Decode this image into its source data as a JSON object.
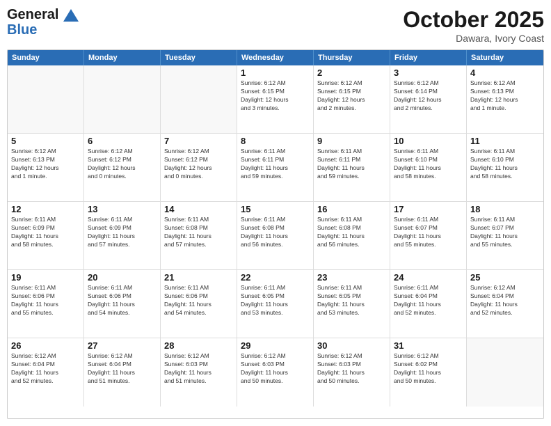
{
  "header": {
    "logo_line1": "General",
    "logo_line2": "Blue",
    "month": "October 2025",
    "location": "Dawara, Ivory Coast"
  },
  "weekdays": [
    "Sunday",
    "Monday",
    "Tuesday",
    "Wednesday",
    "Thursday",
    "Friday",
    "Saturday"
  ],
  "weeks": [
    [
      {
        "day": "",
        "info": "",
        "empty": true
      },
      {
        "day": "",
        "info": "",
        "empty": true
      },
      {
        "day": "",
        "info": "",
        "empty": true
      },
      {
        "day": "1",
        "info": "Sunrise: 6:12 AM\nSunset: 6:15 PM\nDaylight: 12 hours\nand 3 minutes."
      },
      {
        "day": "2",
        "info": "Sunrise: 6:12 AM\nSunset: 6:15 PM\nDaylight: 12 hours\nand 2 minutes."
      },
      {
        "day": "3",
        "info": "Sunrise: 6:12 AM\nSunset: 6:14 PM\nDaylight: 12 hours\nand 2 minutes."
      },
      {
        "day": "4",
        "info": "Sunrise: 6:12 AM\nSunset: 6:13 PM\nDaylight: 12 hours\nand 1 minute."
      }
    ],
    [
      {
        "day": "5",
        "info": "Sunrise: 6:12 AM\nSunset: 6:13 PM\nDaylight: 12 hours\nand 1 minute."
      },
      {
        "day": "6",
        "info": "Sunrise: 6:12 AM\nSunset: 6:12 PM\nDaylight: 12 hours\nand 0 minutes."
      },
      {
        "day": "7",
        "info": "Sunrise: 6:12 AM\nSunset: 6:12 PM\nDaylight: 12 hours\nand 0 minutes."
      },
      {
        "day": "8",
        "info": "Sunrise: 6:11 AM\nSunset: 6:11 PM\nDaylight: 11 hours\nand 59 minutes."
      },
      {
        "day": "9",
        "info": "Sunrise: 6:11 AM\nSunset: 6:11 PM\nDaylight: 11 hours\nand 59 minutes."
      },
      {
        "day": "10",
        "info": "Sunrise: 6:11 AM\nSunset: 6:10 PM\nDaylight: 11 hours\nand 58 minutes."
      },
      {
        "day": "11",
        "info": "Sunrise: 6:11 AM\nSunset: 6:10 PM\nDaylight: 11 hours\nand 58 minutes."
      }
    ],
    [
      {
        "day": "12",
        "info": "Sunrise: 6:11 AM\nSunset: 6:09 PM\nDaylight: 11 hours\nand 58 minutes."
      },
      {
        "day": "13",
        "info": "Sunrise: 6:11 AM\nSunset: 6:09 PM\nDaylight: 11 hours\nand 57 minutes."
      },
      {
        "day": "14",
        "info": "Sunrise: 6:11 AM\nSunset: 6:08 PM\nDaylight: 11 hours\nand 57 minutes."
      },
      {
        "day": "15",
        "info": "Sunrise: 6:11 AM\nSunset: 6:08 PM\nDaylight: 11 hours\nand 56 minutes."
      },
      {
        "day": "16",
        "info": "Sunrise: 6:11 AM\nSunset: 6:08 PM\nDaylight: 11 hours\nand 56 minutes."
      },
      {
        "day": "17",
        "info": "Sunrise: 6:11 AM\nSunset: 6:07 PM\nDaylight: 11 hours\nand 55 minutes."
      },
      {
        "day": "18",
        "info": "Sunrise: 6:11 AM\nSunset: 6:07 PM\nDaylight: 11 hours\nand 55 minutes."
      }
    ],
    [
      {
        "day": "19",
        "info": "Sunrise: 6:11 AM\nSunset: 6:06 PM\nDaylight: 11 hours\nand 55 minutes."
      },
      {
        "day": "20",
        "info": "Sunrise: 6:11 AM\nSunset: 6:06 PM\nDaylight: 11 hours\nand 54 minutes."
      },
      {
        "day": "21",
        "info": "Sunrise: 6:11 AM\nSunset: 6:06 PM\nDaylight: 11 hours\nand 54 minutes."
      },
      {
        "day": "22",
        "info": "Sunrise: 6:11 AM\nSunset: 6:05 PM\nDaylight: 11 hours\nand 53 minutes."
      },
      {
        "day": "23",
        "info": "Sunrise: 6:11 AM\nSunset: 6:05 PM\nDaylight: 11 hours\nand 53 minutes."
      },
      {
        "day": "24",
        "info": "Sunrise: 6:11 AM\nSunset: 6:04 PM\nDaylight: 11 hours\nand 52 minutes."
      },
      {
        "day": "25",
        "info": "Sunrise: 6:12 AM\nSunset: 6:04 PM\nDaylight: 11 hours\nand 52 minutes."
      }
    ],
    [
      {
        "day": "26",
        "info": "Sunrise: 6:12 AM\nSunset: 6:04 PM\nDaylight: 11 hours\nand 52 minutes."
      },
      {
        "day": "27",
        "info": "Sunrise: 6:12 AM\nSunset: 6:04 PM\nDaylight: 11 hours\nand 51 minutes."
      },
      {
        "day": "28",
        "info": "Sunrise: 6:12 AM\nSunset: 6:03 PM\nDaylight: 11 hours\nand 51 minutes."
      },
      {
        "day": "29",
        "info": "Sunrise: 6:12 AM\nSunset: 6:03 PM\nDaylight: 11 hours\nand 50 minutes."
      },
      {
        "day": "30",
        "info": "Sunrise: 6:12 AM\nSunset: 6:03 PM\nDaylight: 11 hours\nand 50 minutes."
      },
      {
        "day": "31",
        "info": "Sunrise: 6:12 AM\nSunset: 6:02 PM\nDaylight: 11 hours\nand 50 minutes."
      },
      {
        "day": "",
        "info": "",
        "empty": true
      }
    ]
  ]
}
